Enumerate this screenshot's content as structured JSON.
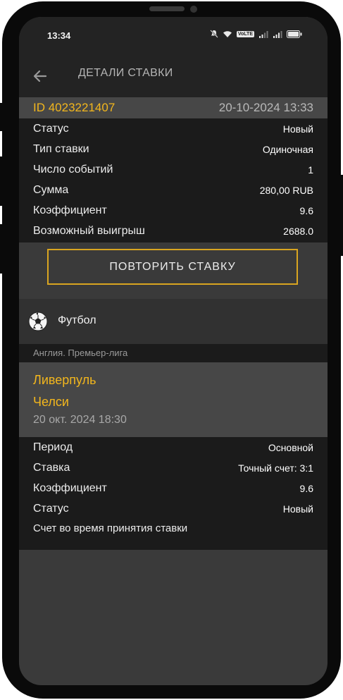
{
  "status_bar": {
    "time": "13:34",
    "volte_label": "VoLTE"
  },
  "app_bar": {
    "title": "ДЕТАЛИ СТАВКИ"
  },
  "bet": {
    "id": "ID 4023221407",
    "datetime": "20-10-2024 13:33",
    "rows": [
      {
        "label": "Статус",
        "value": "Новый"
      },
      {
        "label": "Тип ставки",
        "value": "Одиночная"
      },
      {
        "label": "Число событий",
        "value": "1"
      },
      {
        "label": "Сумма",
        "value": "280,00 RUB"
      },
      {
        "label": "Коэффициент",
        "value": "9.6"
      },
      {
        "label": "Возможный выигрыш",
        "value": "2688.0"
      }
    ],
    "repeat_button": "ПОВТОРИТЬ СТАВКУ"
  },
  "event": {
    "sport": "Футбол",
    "league": "Англия. Премьер-лига",
    "team1": "Ливерпуль",
    "team2": "Челси",
    "date": "20 окт. 2024 18:30",
    "rows": [
      {
        "label": "Период",
        "value": "Основной"
      },
      {
        "label": "Ставка",
        "value": "Точный счет: 3:1"
      },
      {
        "label": "Коэффициент",
        "value": "9.6"
      },
      {
        "label": "Статус",
        "value": "Новый"
      }
    ],
    "score_label": "Счет во время принятия ставки"
  },
  "colors": {
    "accent": "#f2b61d",
    "button_border": "#d9a520",
    "background": "#3a3a3a"
  }
}
